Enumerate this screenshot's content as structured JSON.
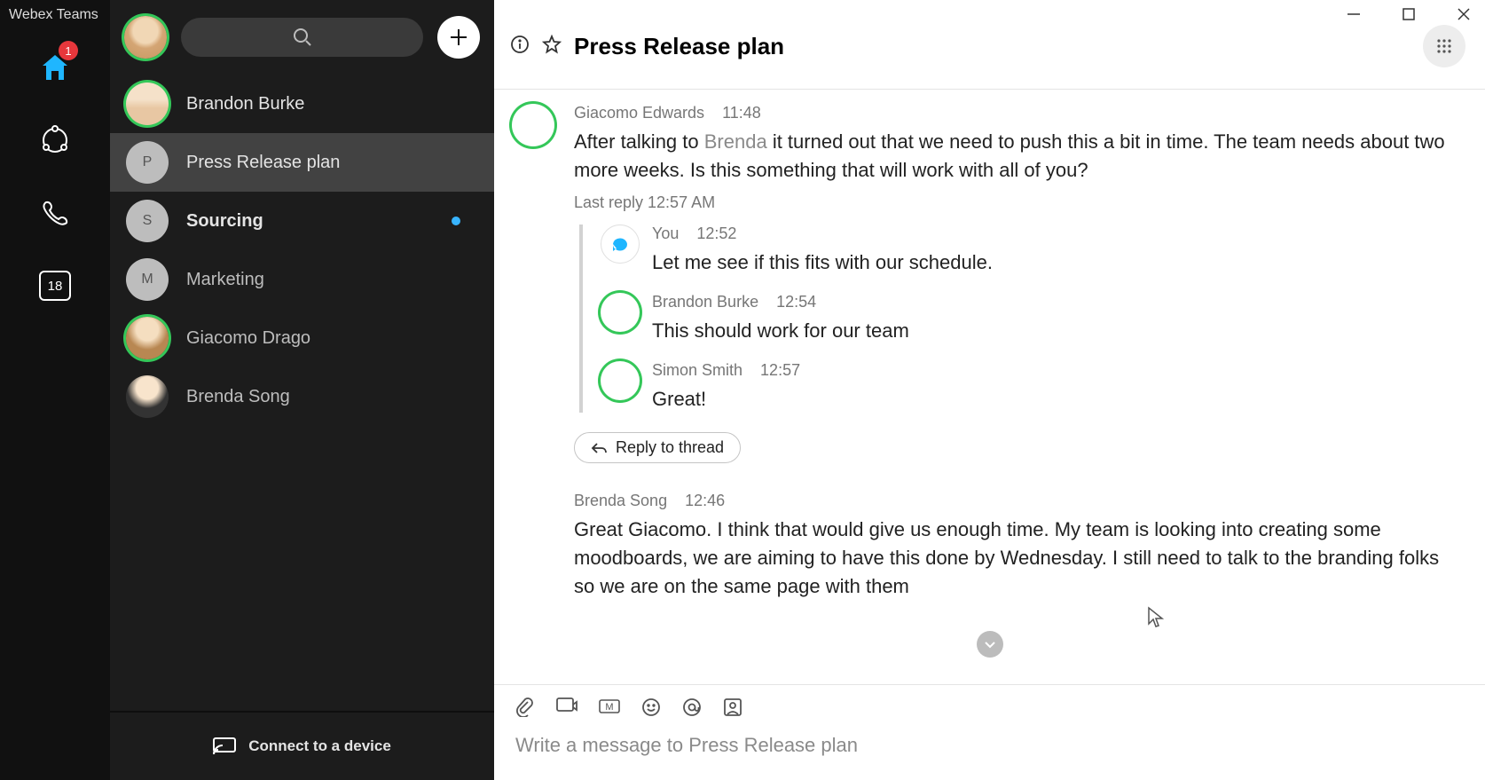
{
  "app": {
    "title": "Webex Teams",
    "home_badge": "1",
    "calendar_day": "18"
  },
  "spaces": {
    "items": [
      {
        "name": "Brandon Burke",
        "initial": "",
        "photo": true,
        "photoClass": "photo-2",
        "ring": true,
        "selected": false,
        "bold": false,
        "muted": false,
        "unread": false
      },
      {
        "name": "Press Release plan",
        "initial": "P",
        "photo": false,
        "ring": false,
        "selected": true,
        "bold": false,
        "muted": false,
        "unread": false
      },
      {
        "name": "Sourcing",
        "initial": "S",
        "photo": false,
        "ring": false,
        "selected": false,
        "bold": true,
        "muted": false,
        "unread": true
      },
      {
        "name": "Marketing",
        "initial": "M",
        "photo": false,
        "ring": false,
        "selected": false,
        "bold": false,
        "muted": true,
        "unread": false
      },
      {
        "name": "Giacomo Drago",
        "initial": "",
        "photo": true,
        "photoClass": "photo-4",
        "ring": true,
        "selected": false,
        "bold": false,
        "muted": true,
        "unread": false
      },
      {
        "name": "Brenda Song",
        "initial": "",
        "photo": true,
        "photoClass": "photo-3",
        "ring": false,
        "selected": false,
        "bold": false,
        "muted": true,
        "unread": false
      }
    ],
    "connect_label": "Connect to a device"
  },
  "chat": {
    "title": "Press Release plan",
    "msg1": {
      "author": "Giacomo Edwards",
      "time": "11:48",
      "pre": "After talking to ",
      "mention": "Brenda",
      "post": " it turned out that we need to push this a bit in time. The team needs about two more weeks. Is this something that will work with all of you?",
      "last_reply": "Last reply 12:57 AM"
    },
    "thread": [
      {
        "author": "You",
        "time": "12:52",
        "text": "Let me see if this fits with our schedule.",
        "you": true
      },
      {
        "author": "Brandon Burke",
        "time": "12:54",
        "text": "This should work for our team",
        "you": false,
        "photoClass": "photo-2",
        "ring": true
      },
      {
        "author": "Simon Smith",
        "time": "12:57",
        "text": "Great!",
        "you": false,
        "photoClass": "photo-5",
        "ring": true
      }
    ],
    "reply_btn": "Reply to thread",
    "msg2": {
      "author": "Brenda Song",
      "time": "12:46",
      "text": "Great Giacomo. I think that would give us enough time. My team is looking into creating some moodboards, we are aiming to have this done by Wednesday. I still need to talk to the branding folks so we are on the same page with them"
    },
    "composer_placeholder": "Write a message to Press Release plan"
  }
}
